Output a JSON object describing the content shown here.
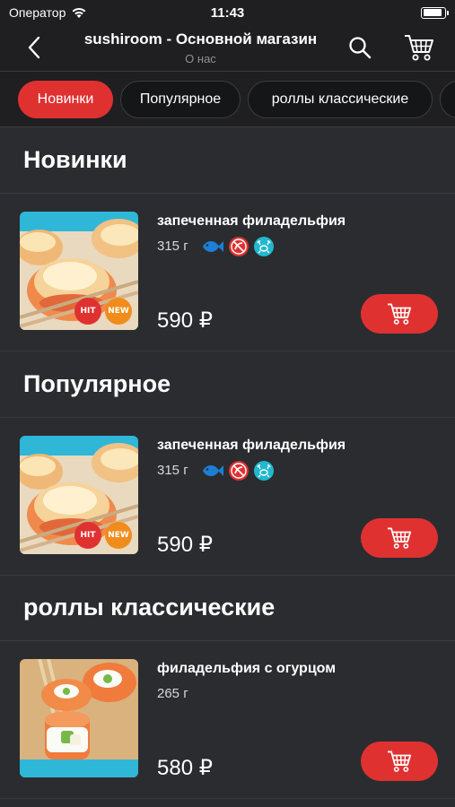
{
  "status_bar": {
    "carrier": "Оператор",
    "time": "11:43",
    "battery_level": 0.95
  },
  "nav": {
    "title": "sushiroom - Основной магазин",
    "subtitle": "О нас"
  },
  "chips": [
    {
      "label": "Новинки",
      "active": true
    },
    {
      "label": "Популярное",
      "active": false
    },
    {
      "label": "роллы классические",
      "active": false
    }
  ],
  "sections": [
    {
      "title": "Новинки",
      "product": {
        "name": "запеченная филадельфия",
        "weight": "315 г",
        "price": "590 ₽",
        "icons": [
          "fish-icon",
          "no-spicy-icon",
          "crab-icon"
        ],
        "badges": [
          "HIT",
          "NEW"
        ]
      }
    },
    {
      "title": "Популярное",
      "product": {
        "name": "запеченная филадельфия",
        "weight": "315 г",
        "price": "590 ₽",
        "icons": [
          "fish-icon",
          "no-spicy-icon",
          "crab-icon"
        ],
        "badges": [
          "HIT",
          "NEW"
        ]
      }
    },
    {
      "title": "роллы классические",
      "product": {
        "name": "филадельфия с огурцом",
        "weight": "265 г",
        "price": "580 ₽",
        "icons": [],
        "badges": []
      }
    }
  ],
  "colors": {
    "accent": "#e03131",
    "background": "#2b2c30",
    "bar": "#1f1f22",
    "badge_new": "#f08c1c",
    "fish": "#1c7ed6",
    "crab": "#22b8cf"
  }
}
